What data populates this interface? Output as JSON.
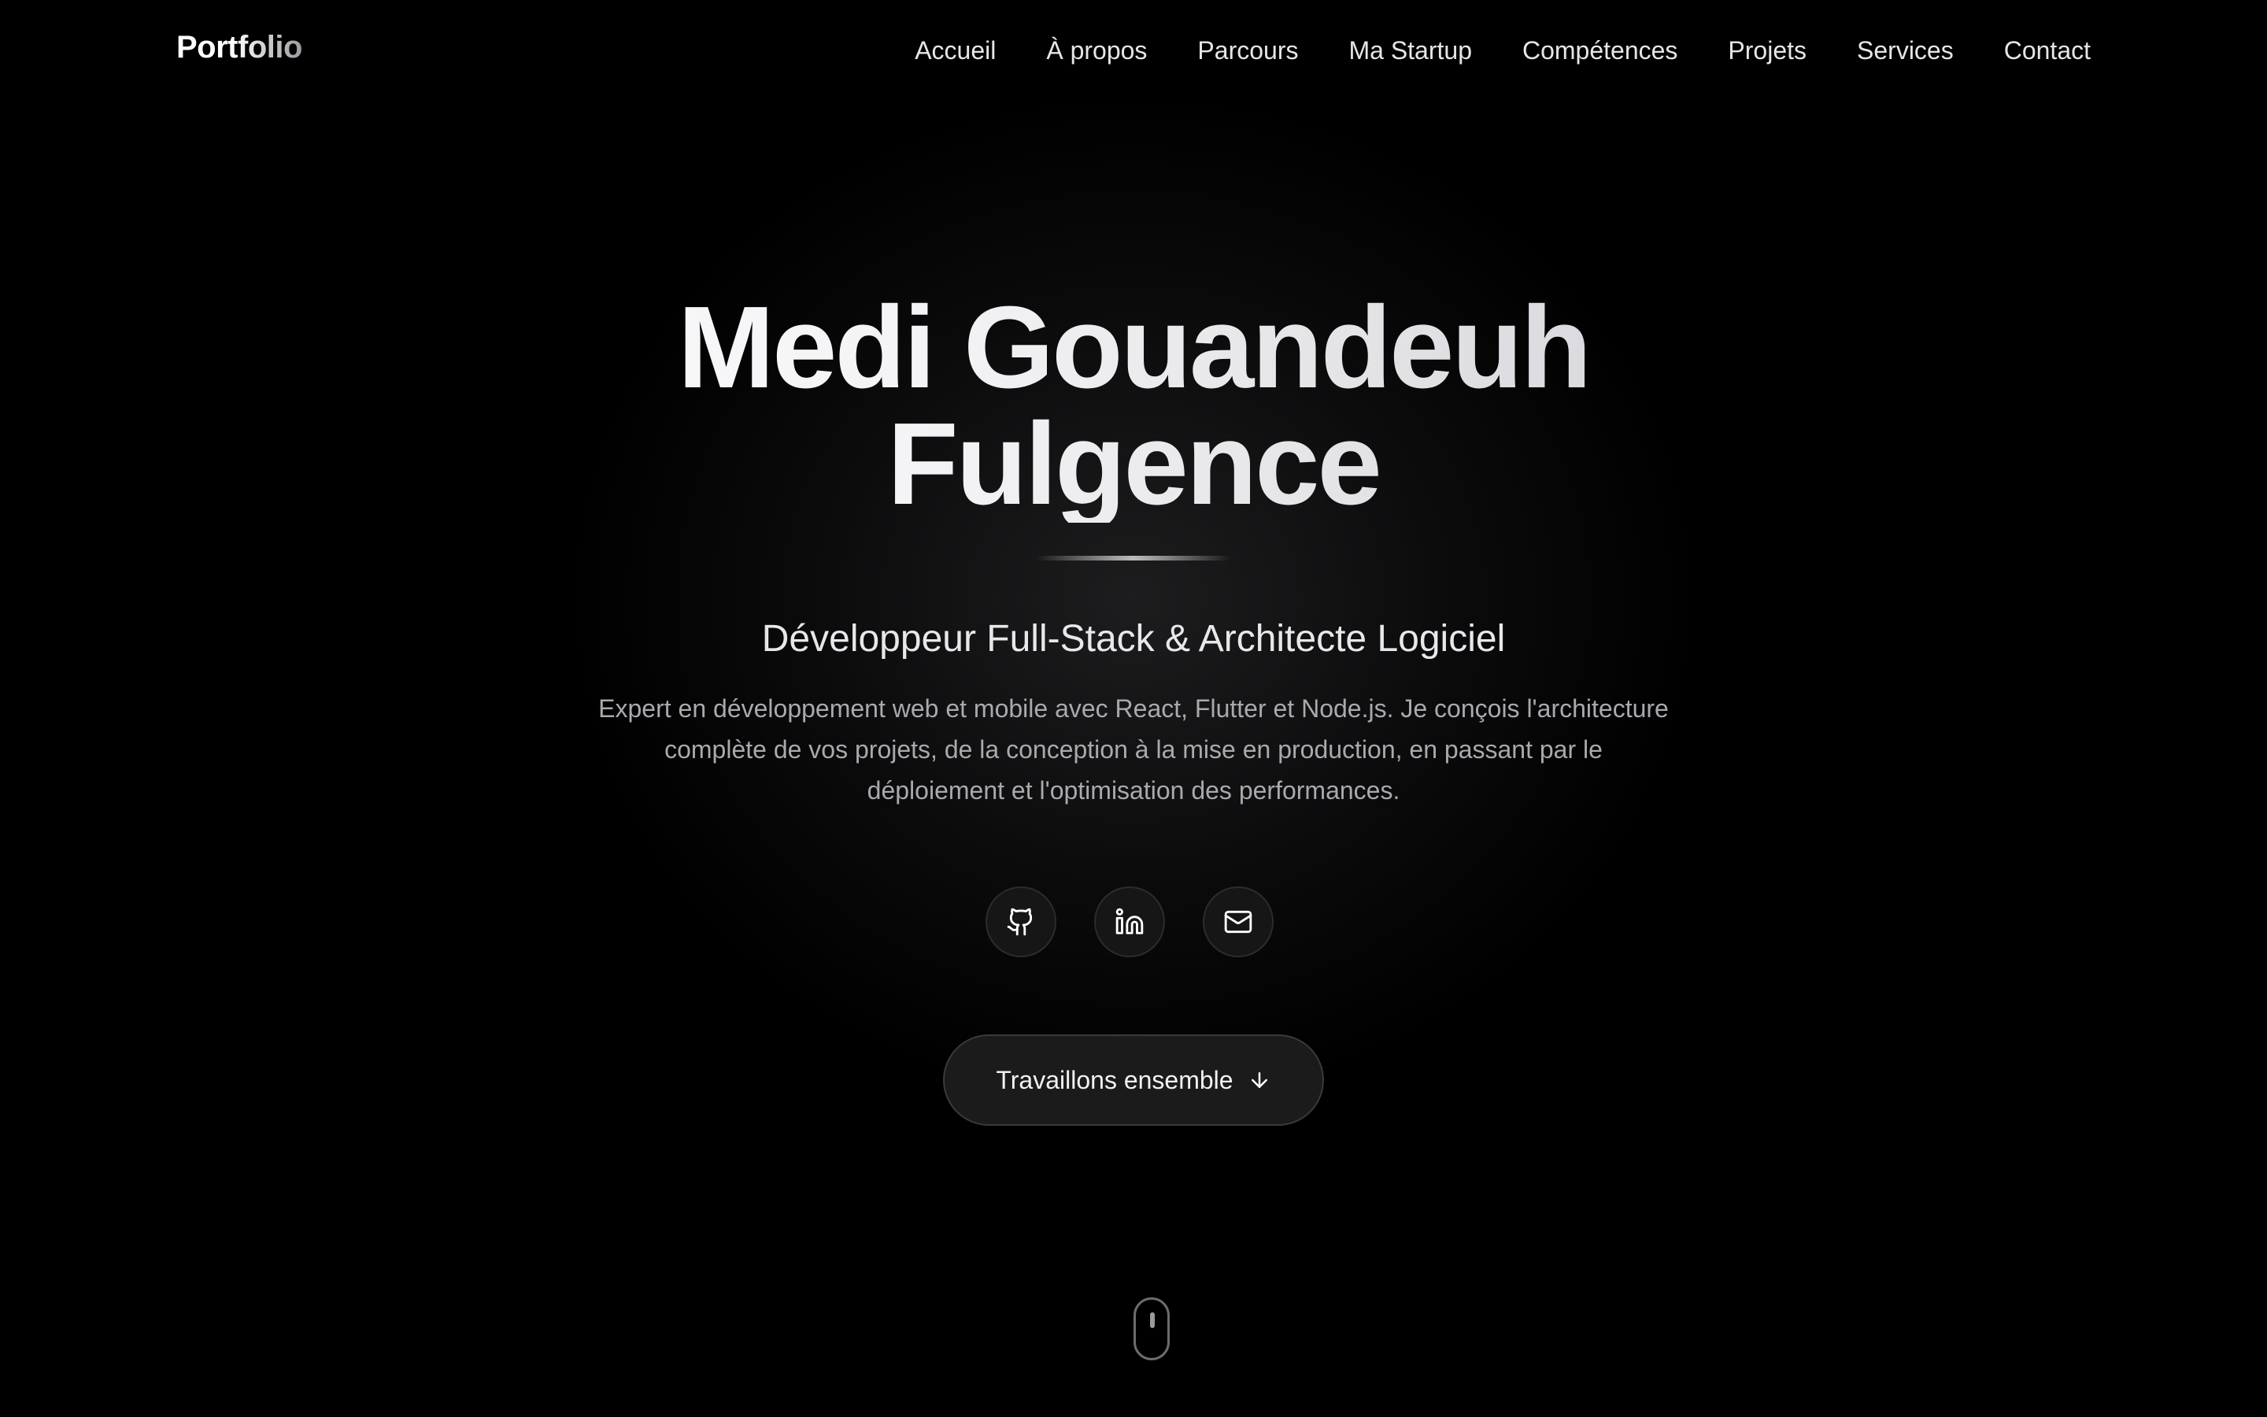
{
  "nav": {
    "logo": "Portfolio",
    "items": [
      {
        "label": "Accueil"
      },
      {
        "label": "À propos"
      },
      {
        "label": "Parcours"
      },
      {
        "label": "Ma Startup"
      },
      {
        "label": "Compétences"
      },
      {
        "label": "Projets"
      },
      {
        "label": "Services"
      },
      {
        "label": "Contact"
      }
    ]
  },
  "hero": {
    "name_line1": "Medi Gouandeuh",
    "name_line2": "Fulgence",
    "subtitle": "Développeur Full-Stack & Architecte Logiciel",
    "description": "Expert en développement web et mobile avec React, Flutter et Node.js. Je conçois l'architecture complète de vos projets, de la conception à la mise en production, en passant par le déploiement et l'optimisation des performances.",
    "cta_label": "Travaillons ensemble"
  },
  "socials": [
    {
      "icon": "github-icon"
    },
    {
      "icon": "linkedin-icon"
    },
    {
      "icon": "mail-icon"
    }
  ],
  "colors": {
    "background": "#000000",
    "text": "#ffffff",
    "muted_text": "#a9a9ae",
    "button_bg": "#1b1b1c"
  }
}
